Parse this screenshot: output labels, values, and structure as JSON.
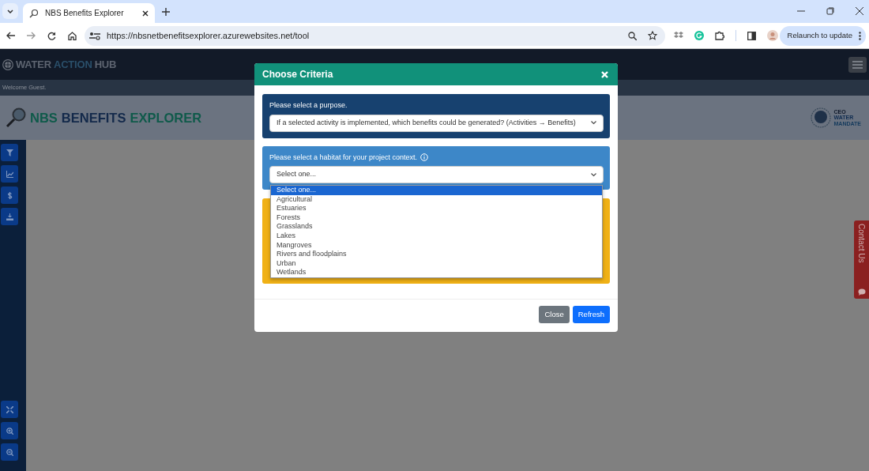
{
  "browser": {
    "tab_title": "NBS Benefits Explorer",
    "url": "https://nbsnetbenefitsexplorer.azurewebsites.net/tool",
    "relaunch_button": "Relaunch to update"
  },
  "site": {
    "brand": [
      {
        "text": "WATER",
        "kind": "plain"
      },
      {
        "text": "ACTION",
        "kind": "accent"
      },
      {
        "text": "HUB",
        "kind": "plain"
      }
    ],
    "welcome": "Welcome Guest.",
    "app_title": [
      {
        "text": "NBS",
        "kind": "green"
      },
      {
        "text": "BENEFITS",
        "kind": "navy"
      },
      {
        "text": "EXPLORER",
        "kind": "green"
      }
    ],
    "partner_logo": [
      "CEO",
      "WATER",
      "MANDATE"
    ],
    "contact_tab": "Contact Us"
  },
  "modal": {
    "title": "Choose Criteria",
    "purpose": {
      "label": "Please select a purpose.",
      "value": "If a selected activity is implemented, which benefits could be generated? (Activities → Benefits)"
    },
    "habitat": {
      "label": "Please select a habitat for your project context.",
      "value": "Select one...",
      "expanded": true,
      "options": [
        {
          "label": "Select one...",
          "selected": true
        },
        {
          "label": "Agricultural",
          "selected": false
        },
        {
          "label": "Estuaries",
          "selected": false
        },
        {
          "label": "Forests",
          "selected": false
        },
        {
          "label": "Grasslands",
          "selected": false
        },
        {
          "label": "Lakes",
          "selected": false
        },
        {
          "label": "Mangroves",
          "selected": false
        },
        {
          "label": "Rivers and floodplains",
          "selected": false
        },
        {
          "label": "Urban",
          "selected": false
        },
        {
          "label": "Wetlands",
          "selected": false
        }
      ]
    },
    "buttons": [
      {
        "label": "Close",
        "kind": "secondary"
      },
      {
        "label": "Refresh",
        "kind": "primary"
      }
    ]
  }
}
